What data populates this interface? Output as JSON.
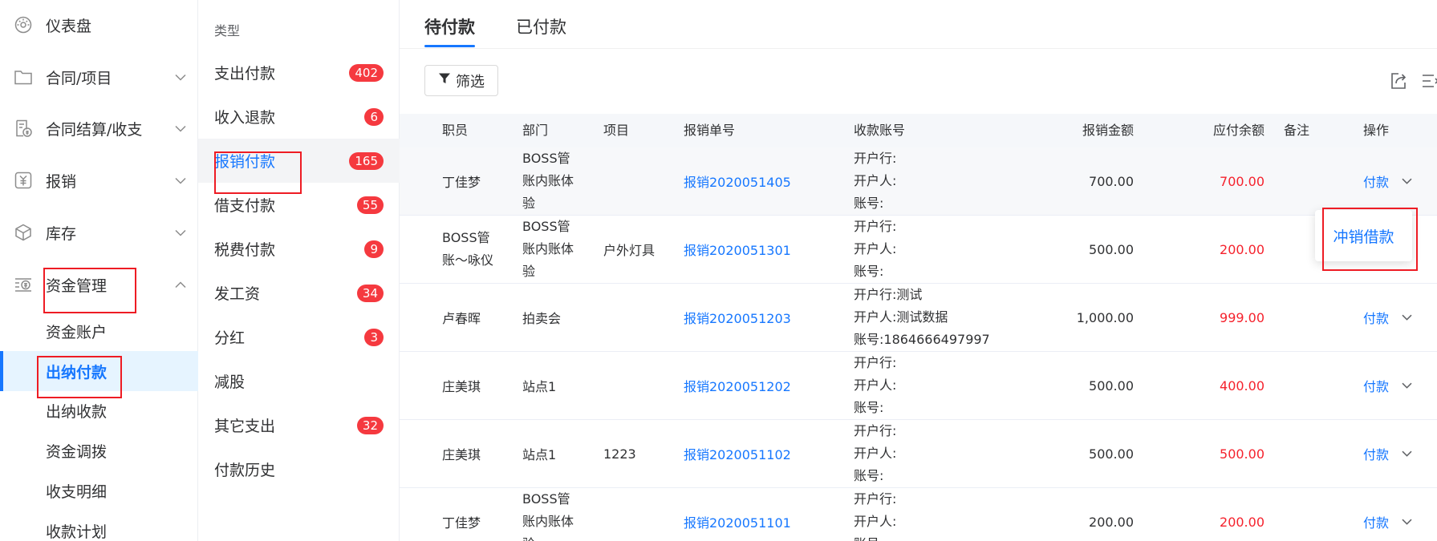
{
  "sidebar": {
    "items": [
      {
        "label": "仪表盘",
        "icon": "dashboard-icon"
      },
      {
        "label": "合同/项目",
        "icon": "folder-icon"
      },
      {
        "label": "合同结算/收支",
        "icon": "settlement-icon"
      },
      {
        "label": "报销",
        "icon": "reimburse-icon"
      },
      {
        "label": "库存",
        "icon": "cube-icon"
      },
      {
        "label": "资金管理",
        "icon": "money-icon"
      }
    ],
    "sub_items": [
      {
        "label": "资金账户"
      },
      {
        "label": "出纳付款"
      },
      {
        "label": "出纳收款"
      },
      {
        "label": "资金调拨"
      },
      {
        "label": "收支明细"
      },
      {
        "label": "收款计划"
      }
    ]
  },
  "categories": {
    "title": "类型",
    "items": [
      {
        "label": "支出付款",
        "badge": "402"
      },
      {
        "label": "收入退款",
        "badge": "6"
      },
      {
        "label": "报销付款",
        "badge": "165"
      },
      {
        "label": "借支付款",
        "badge": "55"
      },
      {
        "label": "税费付款",
        "badge": "9"
      },
      {
        "label": "发工资",
        "badge": "34"
      },
      {
        "label": "分红",
        "badge": "3"
      },
      {
        "label": "减股",
        "badge": ""
      },
      {
        "label": "其它支出",
        "badge": "32"
      },
      {
        "label": "付款历史",
        "badge": ""
      }
    ]
  },
  "tabs": [
    {
      "label": "待付款"
    },
    {
      "label": "已付款"
    }
  ],
  "toolbar": {
    "filter_label": "筛选"
  },
  "table": {
    "headers": {
      "staff": "职员",
      "dept": "部门",
      "project": "项目",
      "order": "报销单号",
      "account": "收款账号",
      "amount": "报销金额",
      "due": "应付余额",
      "note": "备注",
      "action": "操作"
    },
    "rows": [
      {
        "staff": [
          "丁佳梦"
        ],
        "dept": [
          "BOSS管",
          "账内账体",
          "验"
        ],
        "project": "",
        "order": "报销2020051405",
        "account": [
          "开户行:",
          "开户人:",
          "账号:"
        ],
        "amount": "700.00",
        "due": "700.00",
        "action": "付款"
      },
      {
        "staff": [
          "BOSS管",
          "账～咏仪"
        ],
        "dept": [
          "BOSS管",
          "账内账体",
          "验"
        ],
        "project": "户外灯具",
        "order": "报销2020051301",
        "account": [
          "开户行:",
          "开户人:",
          "账号:"
        ],
        "amount": "500.00",
        "due": "200.00",
        "action": ""
      },
      {
        "staff": [
          "卢春晖"
        ],
        "dept": [
          "拍卖会"
        ],
        "project": "",
        "order": "报销2020051203",
        "account": [
          "开户行:测试",
          "开户人:测试数据",
          "账号:1864666497997"
        ],
        "amount": "1,000.00",
        "due": "999.00",
        "action": "付款"
      },
      {
        "staff": [
          "庄美琪"
        ],
        "dept": [
          "站点1"
        ],
        "project": "",
        "order": "报销2020051202",
        "account": [
          "开户行:",
          "开户人:",
          "账号:"
        ],
        "amount": "500.00",
        "due": "400.00",
        "action": "付款"
      },
      {
        "staff": [
          "庄美琪"
        ],
        "dept": [
          "站点1"
        ],
        "project": "1223",
        "order": "报销2020051102",
        "account": [
          "开户行:",
          "开户人:",
          "账号:"
        ],
        "amount": "500.00",
        "due": "500.00",
        "action": "付款"
      },
      {
        "staff": [
          "丁佳梦"
        ],
        "dept": [
          "BOSS管",
          "账内账体",
          "验"
        ],
        "project": "",
        "order": "报销2020051101",
        "account": [
          "开户行:",
          "开户人:",
          "账号:"
        ],
        "amount": "200.00",
        "due": "200.00",
        "action": "付款"
      }
    ]
  },
  "dropdown": {
    "item": "冲销借款"
  },
  "colors": {
    "accent": "#1677ff",
    "badge": "#f5393f",
    "due": "#f5222d",
    "annotation": "#ee1c24"
  }
}
